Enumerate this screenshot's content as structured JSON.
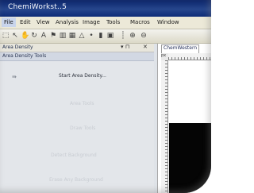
{
  "window": {
    "title": "ChemiWorkst..5"
  },
  "menubar": {
    "items": [
      "File",
      "Edit",
      "View",
      "Analysis",
      "Image",
      "Tools",
      "Macros",
      "Window"
    ]
  },
  "toolbar": {
    "icons": [
      "select-icon",
      "arrow-icon",
      "hand-icon",
      "rotate-icon",
      "letter-a-icon",
      "flag-icon",
      "barcode-icon",
      "grid-icon",
      "triangle-icon",
      "dot-icon",
      "bar-icon",
      "image-icon",
      "divider-icon",
      "zoom-icon",
      "zoom-icon-2"
    ],
    "icon_glyphs": [
      "⬚",
      "↖",
      "✋",
      "↻",
      "A",
      "⚑",
      "▥",
      "▦",
      "△",
      "•",
      "▮",
      "▣",
      "┊",
      "⊕",
      "⊖"
    ]
  },
  "panel": {
    "title": "Area Density",
    "pin": "▾ ⊓",
    "close": "✕",
    "subheader": "Area Density Tools",
    "tasks": {
      "start": "Start Area Density...",
      "t2": "Area Tools",
      "t3": "Draw Tools",
      "t4": "Detect Background",
      "t5": "Erase Any Background"
    }
  },
  "document": {
    "tab": "ChemWestern"
  }
}
